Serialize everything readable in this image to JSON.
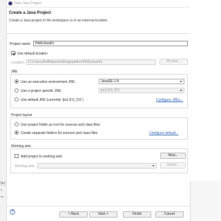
{
  "window": {
    "title": "New Java Project"
  },
  "header": {
    "title": "Create a Java Project",
    "description": "Create a Java project in the workspace or in an external location."
  },
  "project": {
    "name_label": "Project name:",
    "name_value": "HelloJavaFx",
    "use_default_location_label": "Use default location",
    "use_default_location_checked": true,
    "location_label": "Location:",
    "location_value": "C:\\Users\\AnilBalwani\\designpattern\\HelloJavaFx",
    "browse_label": "Browse..."
  },
  "jre": {
    "group_label": "JRE",
    "option_env_label": "Use an execution environment JRE:",
    "option_env_value": "JavaSE-1.8",
    "option_specific_label": "Use a project specific JRE:",
    "option_specific_value": "jre1.8.0_211",
    "option_default_label": "Use default JRE (currently 'jre1.8.0_211')",
    "configure_jres_link": "Configure JREs..."
  },
  "layout": {
    "group_label": "Project layout",
    "option_root_label": "Use project folder as root for sources and class files",
    "option_separate_label": "Create separate folders for sources and class files",
    "configure_default_link": "Configure default..."
  },
  "working_sets": {
    "group_label": "Working sets",
    "add_label": "Add project to working sets",
    "new_label": "New...",
    "field_label": "Working sets:",
    "select_label": "Select..."
  },
  "footer": {
    "help_label": "?",
    "back_label": "< Back",
    "next_label": "Next >",
    "finish_label": "Finish",
    "cancel_label": "Cancel"
  },
  "background": {
    "tab_label": "Ma",
    "row1": "lr",
    "row2": "sc"
  }
}
